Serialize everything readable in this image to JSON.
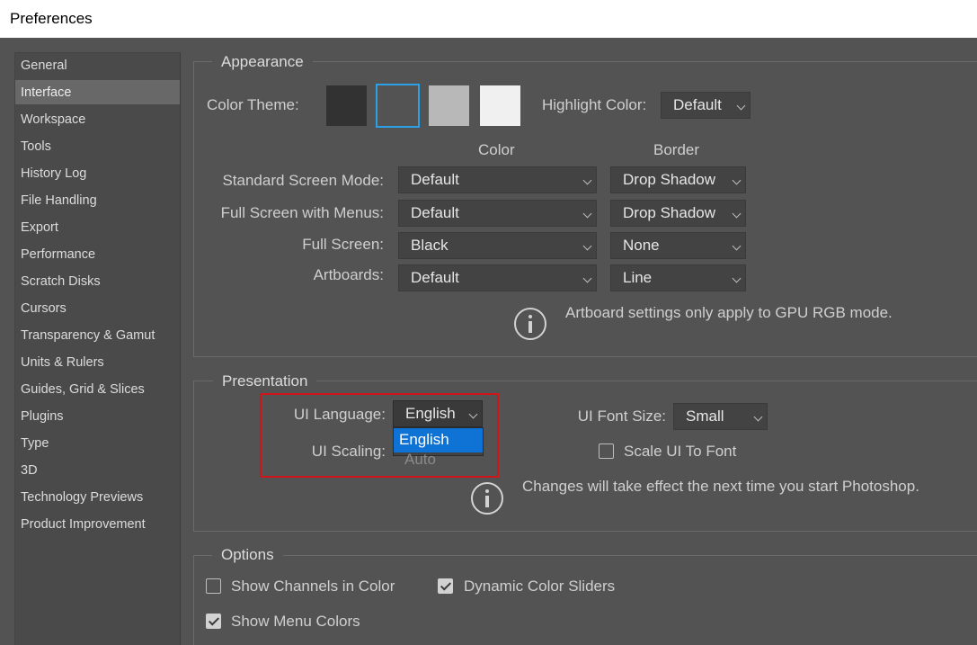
{
  "window": {
    "title": "Preferences"
  },
  "sidebar": {
    "items": [
      "General",
      "Interface",
      "Workspace",
      "Tools",
      "History Log",
      "File Handling",
      "Export",
      "Performance",
      "Scratch Disks",
      "Cursors",
      "Transparency & Gamut",
      "Units & Rulers",
      "Guides, Grid & Slices",
      "Plugins",
      "Type",
      "3D",
      "Technology Previews",
      "Product Improvement"
    ],
    "selected_index": 1
  },
  "appearance": {
    "title": "Appearance",
    "color_theme_label": "Color Theme:",
    "theme_swatches": [
      "#323232",
      "#535353",
      "#b8b8b8",
      "#f0f0f0"
    ],
    "selected_theme_index": 1,
    "highlight_label": "Highlight Color:",
    "highlight_value": "Default",
    "color_header": "Color",
    "border_header": "Border",
    "rows": [
      {
        "label": "Standard Screen Mode:",
        "color": "Default",
        "border": "Drop Shadow"
      },
      {
        "label": "Full Screen with Menus:",
        "color": "Default",
        "border": "Drop Shadow"
      },
      {
        "label": "Full Screen:",
        "color": "Black",
        "border": "None"
      },
      {
        "label": "Artboards:",
        "color": "Default",
        "border": "Line"
      }
    ],
    "info_text": "Artboard settings only apply to GPU RGB mode."
  },
  "presentation": {
    "title": "Presentation",
    "ui_language_label": "UI Language:",
    "ui_language_value": "English",
    "ui_language_options": [
      "English"
    ],
    "ui_scaling_label": "UI Scaling:",
    "ui_scaling_value": "Auto",
    "ui_font_size_label": "UI Font Size:",
    "ui_font_size_value": "Small",
    "scale_ui_label": "Scale UI To Font",
    "scale_ui_checked": false,
    "info_text": "Changes will take effect the next time you start Photoshop."
  },
  "options": {
    "title": "Options",
    "show_channels_label": "Show Channels in Color",
    "show_channels_checked": false,
    "dynamic_sliders_label": "Dynamic Color Sliders",
    "dynamic_sliders_checked": true,
    "show_menu_colors_label": "Show Menu Colors",
    "show_menu_colors_checked": true
  },
  "colors": {
    "accent_selection": "#2d9fe6",
    "dropdown_highlight": "#0f73d6",
    "annotation_box": "#d0141b"
  }
}
